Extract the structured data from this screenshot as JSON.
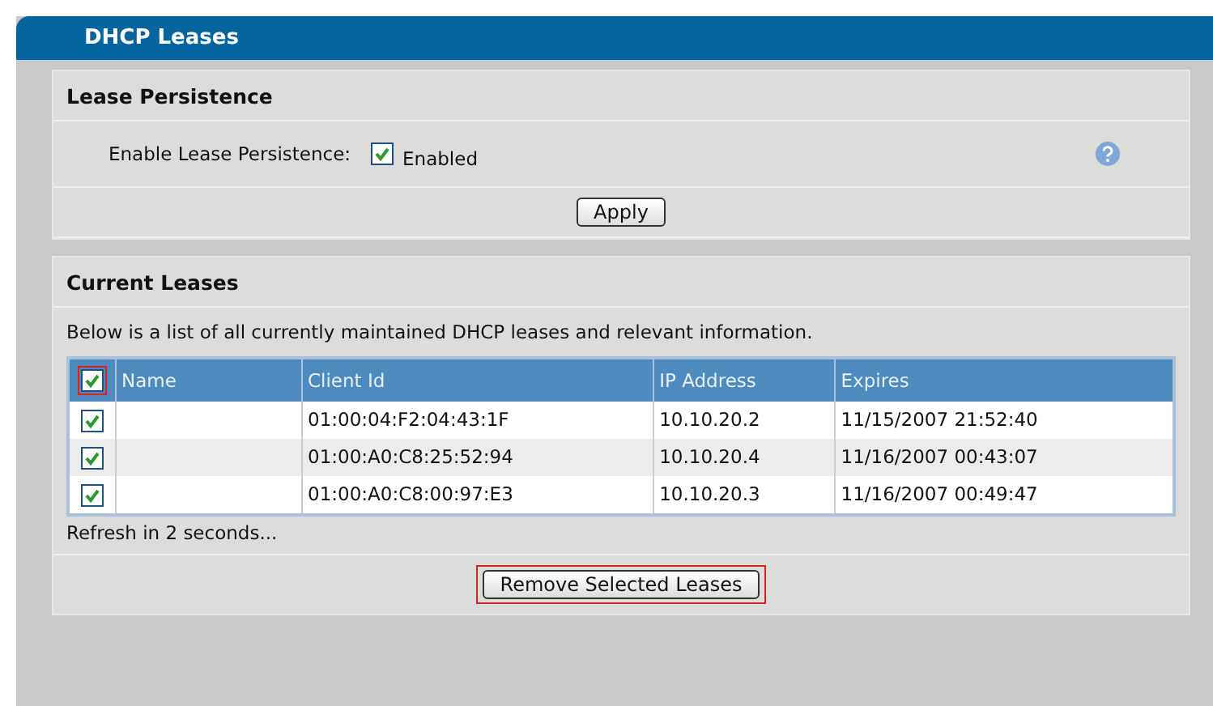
{
  "panel": {
    "title": "DHCP Leases"
  },
  "persistence": {
    "title": "Lease Persistence",
    "label": "Enable Lease Persistence:",
    "checkbox": {
      "label": "Enabled",
      "checked": true
    },
    "apply": "Apply"
  },
  "leases": {
    "title": "Current Leases",
    "description": "Below is a list of all currently maintained DHCP leases and relevant information.",
    "select_all": {
      "checked": true,
      "highlighted": true
    },
    "columns": [
      "Name",
      "Client Id",
      "IP Address",
      "Expires"
    ],
    "rows": [
      {
        "checked": true,
        "cells": [
          "",
          "01:00:04:F2:04:43:1F",
          "10.10.20.2",
          "11/15/2007 21:52:40"
        ]
      },
      {
        "checked": true,
        "cells": [
          "",
          "01:00:A0:C8:25:52:94",
          "10.10.20.4",
          "11/16/2007 00:43:07"
        ]
      },
      {
        "checked": true,
        "cells": [
          "",
          "01:00:A0:C8:00:97:E3",
          "10.10.20.3",
          "11/16/2007 00:49:47"
        ]
      }
    ],
    "refresh": "Refresh in 2 seconds...",
    "remove": {
      "label": "Remove Selected Leases",
      "highlighted": true
    }
  }
}
